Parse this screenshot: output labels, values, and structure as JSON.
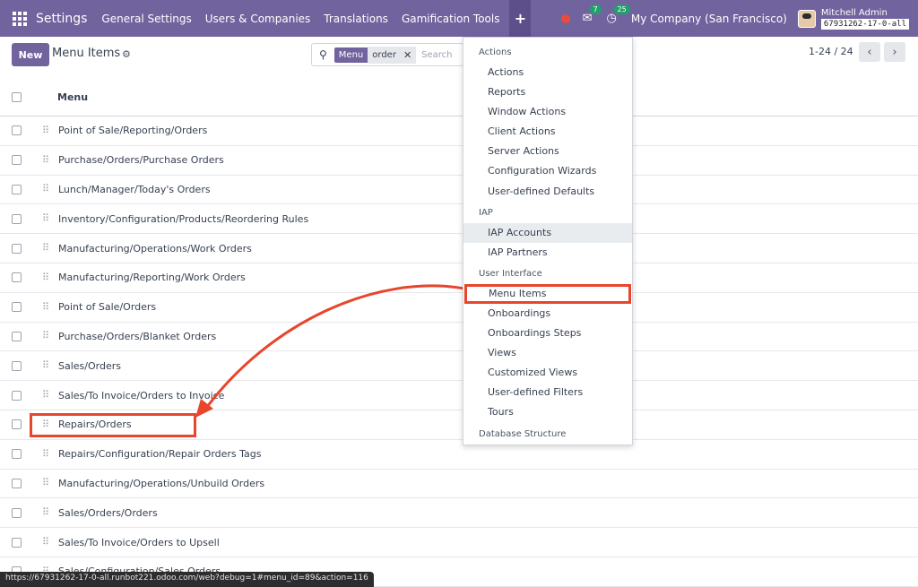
{
  "navbar": {
    "brand": "Settings",
    "menu": [
      "General Settings",
      "Users & Companies",
      "Translations",
      "Gamification Tools"
    ],
    "plus": "+",
    "messages_count": "7",
    "activities_count": "25",
    "company": "My Company (San Francisco)",
    "user": "Mitchell Admin",
    "database": "67931262-17-0-all"
  },
  "control": {
    "new_label": "New",
    "title": "Menu Items",
    "search": {
      "facet_label": "Menu",
      "facet_value": "order",
      "placeholder": "Search"
    },
    "pager": "1-24 / 24"
  },
  "list": {
    "column": "Menu",
    "rows": [
      "Point of Sale/Reporting/Orders",
      "Purchase/Orders/Purchase Orders",
      "Lunch/Manager/Today's Orders",
      "Inventory/Configuration/Products/Reordering Rules",
      "Manufacturing/Operations/Work Orders",
      "Manufacturing/Reporting/Work Orders",
      "Point of Sale/Orders",
      "Purchase/Orders/Blanket Orders",
      "Sales/Orders",
      "Sales/To Invoice/Orders to Invoice",
      "Repairs/Orders",
      "Repairs/Configuration/Repair Orders Tags",
      "Manufacturing/Operations/Unbuild Orders",
      "Sales/Orders/Orders",
      "Sales/To Invoice/Orders to Upsell",
      "Sales/Configuration/Sales Orders"
    ]
  },
  "dropdown": {
    "sections": [
      {
        "title": "Actions",
        "items": [
          "Actions",
          "Reports",
          "Window Actions",
          "Client Actions",
          "Server Actions",
          "Configuration Wizards",
          "User-defined Defaults"
        ]
      },
      {
        "title": "IAP",
        "items": [
          "IAP Accounts",
          "IAP Partners"
        ]
      },
      {
        "title": "User Interface",
        "items": [
          "Menu Items",
          "Onboardings",
          "Onboardings Steps",
          "Views",
          "Customized Views",
          "User-defined Filters",
          "Tours"
        ]
      },
      {
        "title": "Database Structure",
        "items": []
      }
    ],
    "hovered_item": "IAP Accounts",
    "highlighted_item": "Menu Items"
  },
  "status_url": "https://67931262-17-0-all.runbot221.odoo.com/web?debug=1#menu_id=89&action=116",
  "colors": {
    "brand": "#71639e",
    "highlight": "#e8452c"
  }
}
